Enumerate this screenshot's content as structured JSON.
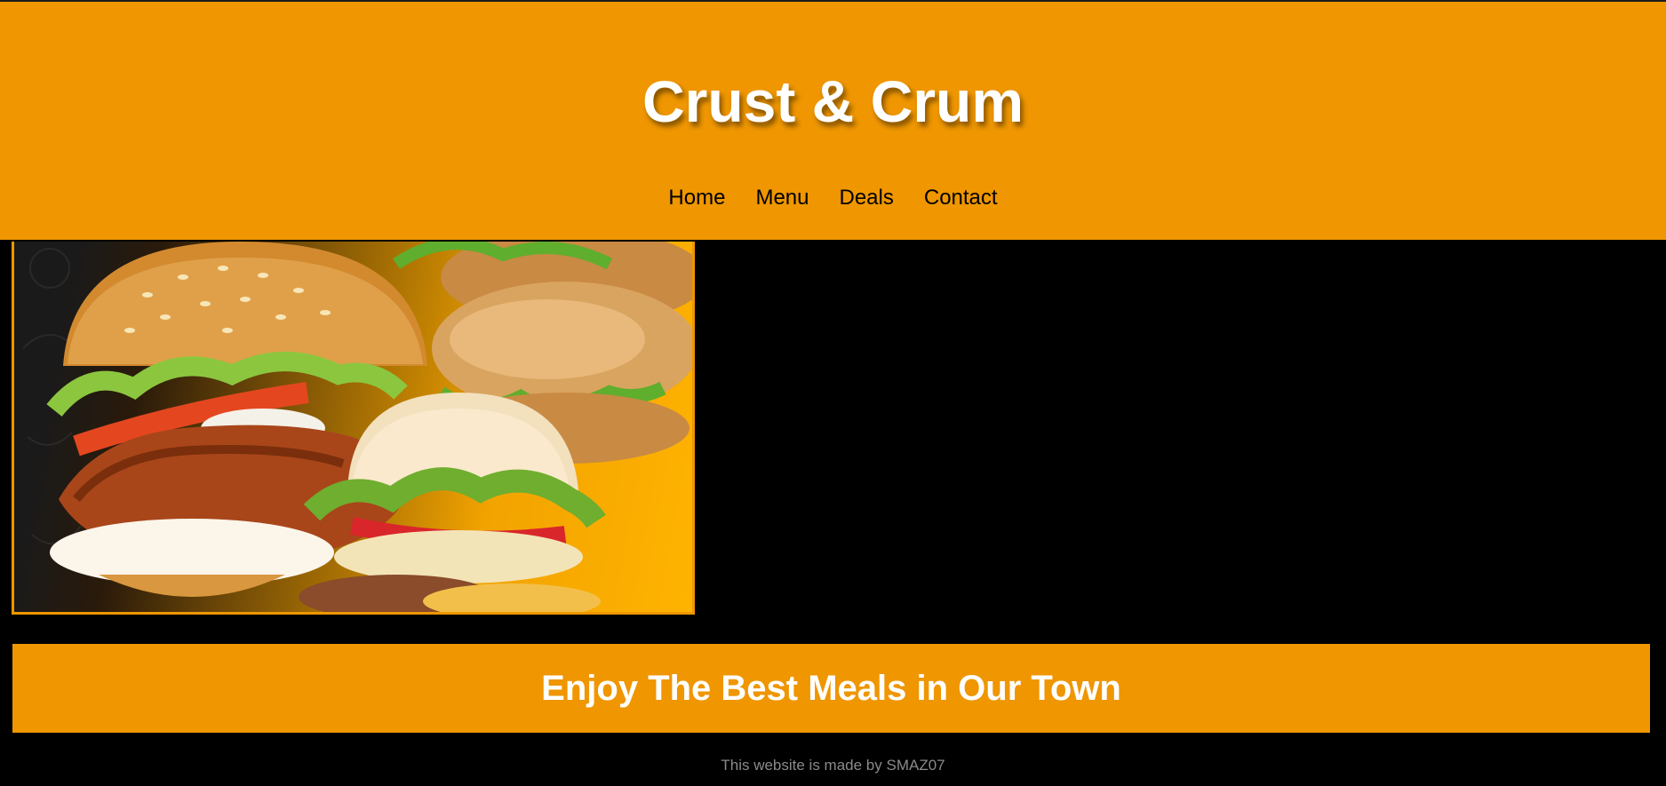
{
  "header": {
    "title": "Crust & Crum",
    "nav": [
      {
        "label": "Home"
      },
      {
        "label": "Menu"
      },
      {
        "label": "Deals"
      },
      {
        "label": "Contact"
      }
    ]
  },
  "hero": {
    "image_name": "burger-collage-image"
  },
  "banner": {
    "text": "Enjoy The Best Meals in Our Town"
  },
  "footer": {
    "text": "This website is made by SMAZ07"
  },
  "colors": {
    "accent": "#ef9600",
    "background": "#000000",
    "title_text": "#ffffff",
    "footer_text": "#8a8a8a"
  }
}
